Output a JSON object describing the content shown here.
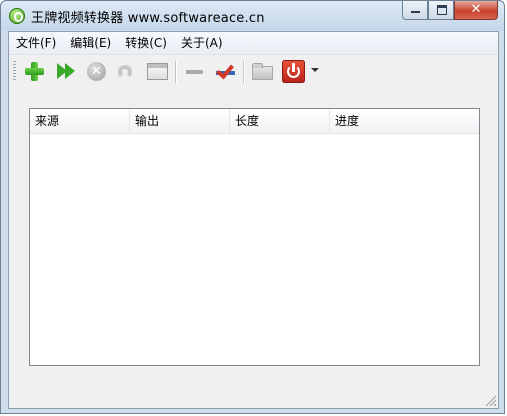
{
  "window": {
    "title": "王牌视频转换器 www.softwareace.cn",
    "minimize_symbol": "",
    "maximize_symbol": "",
    "close_symbol": "✕"
  },
  "menu": {
    "items": [
      {
        "label": "文件(F)"
      },
      {
        "label": "编辑(E)"
      },
      {
        "label": "转换(C)"
      },
      {
        "label": "关于(A)"
      }
    ]
  },
  "toolbar": {
    "buttons": [
      {
        "icon": "add-icon",
        "enabled": true
      },
      {
        "icon": "start-convert-icon",
        "enabled": true
      },
      {
        "icon": "stop-icon",
        "enabled": false
      },
      {
        "icon": "redo-icon",
        "enabled": false
      },
      {
        "icon": "settings-window-icon",
        "enabled": false
      },
      {
        "icon": "remove-icon",
        "enabled": false
      },
      {
        "icon": "check-all-icon",
        "enabled": true
      },
      {
        "icon": "open-folder-icon",
        "enabled": false
      },
      {
        "icon": "power-icon",
        "enabled": true
      },
      {
        "icon": "dropdown-arrow-icon",
        "enabled": true
      }
    ],
    "stop_glyph": "✕"
  },
  "list": {
    "columns": [
      {
        "label": "来源"
      },
      {
        "label": "输出"
      },
      {
        "label": "长度"
      },
      {
        "label": "进度"
      }
    ],
    "rows": []
  },
  "colors": {
    "titlebar": "#c4d6e9",
    "close_button": "#c8452f",
    "accent_green": "#3aa82b",
    "power_red": "#b8231a"
  }
}
